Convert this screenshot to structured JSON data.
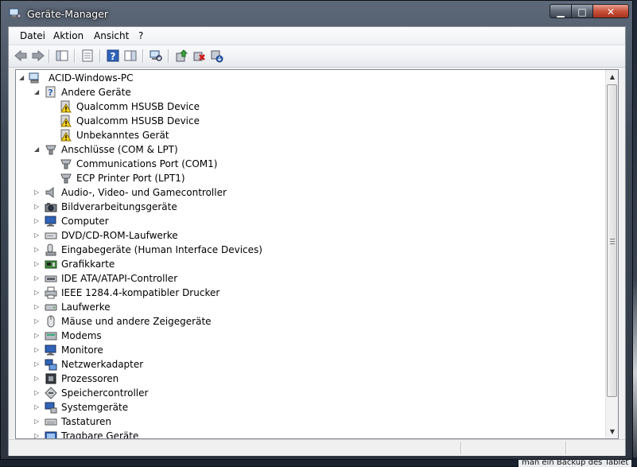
{
  "window": {
    "title": "Geräte-Manager",
    "minimize_glyph": "▁",
    "maximize_glyph": "□",
    "close_glyph": "✕"
  },
  "menu": [
    "Datei",
    "Aktion",
    "Ansicht",
    "?"
  ],
  "toolbar": [
    "back-icon",
    "forward-icon",
    "show-hide-console-tree-icon",
    "properties-icon",
    "help-icon",
    "action-pane-icon",
    "scan-hardware-icon",
    "update-driver-icon",
    "uninstall-icon",
    "disable-icon"
  ],
  "tree": {
    "root": "ACID-Windows-PC",
    "items": [
      {
        "label": "Andere Geräte",
        "level": 1,
        "expanded": true,
        "icon": "unknown-device-icon"
      },
      {
        "label": "Qualcomm HSUSB Device",
        "level": 2,
        "icon": "warning-device-icon"
      },
      {
        "label": "Qualcomm HSUSB Device",
        "level": 2,
        "icon": "warning-device-icon"
      },
      {
        "label": "Unbekanntes Gerät",
        "level": 2,
        "icon": "warning-device-icon"
      },
      {
        "label": "Anschlüsse (COM & LPT)",
        "level": 1,
        "expanded": true,
        "icon": "port-icon"
      },
      {
        "label": "Communications Port (COM1)",
        "level": 2,
        "icon": "port-icon"
      },
      {
        "label": "ECP Printer Port (LPT1)",
        "level": 2,
        "icon": "port-icon"
      },
      {
        "label": "Audio-, Video- und Gamecontroller",
        "level": 1,
        "expanded": false,
        "icon": "speaker-icon"
      },
      {
        "label": "Bildverarbeitungsgeräte",
        "level": 1,
        "expanded": false,
        "icon": "camera-icon"
      },
      {
        "label": "Computer",
        "level": 1,
        "expanded": false,
        "icon": "monitor-icon"
      },
      {
        "label": "DVD/CD-ROM-Laufwerke",
        "level": 1,
        "expanded": false,
        "icon": "optical-drive-icon"
      },
      {
        "label": "Eingabegeräte (Human Interface Devices)",
        "level": 1,
        "expanded": false,
        "icon": "hid-icon"
      },
      {
        "label": "Grafikkarte",
        "level": 1,
        "expanded": false,
        "icon": "display-adapter-icon"
      },
      {
        "label": "IDE ATA/ATAPI-Controller",
        "level": 1,
        "expanded": false,
        "icon": "ide-controller-icon"
      },
      {
        "label": "IEEE 1284.4-kompatibler Drucker",
        "level": 1,
        "expanded": false,
        "icon": "printer-icon"
      },
      {
        "label": "Laufwerke",
        "level": 1,
        "expanded": false,
        "icon": "disk-drive-icon"
      },
      {
        "label": "Mäuse und andere Zeigegeräte",
        "level": 1,
        "expanded": false,
        "icon": "mouse-icon"
      },
      {
        "label": "Modems",
        "level": 1,
        "expanded": false,
        "icon": "modem-icon"
      },
      {
        "label": "Monitore",
        "level": 1,
        "expanded": false,
        "icon": "monitor-icon"
      },
      {
        "label": "Netzwerkadapter",
        "level": 1,
        "expanded": false,
        "icon": "network-adapter-icon"
      },
      {
        "label": "Prozessoren",
        "level": 1,
        "expanded": false,
        "icon": "processor-icon"
      },
      {
        "label": "Speichercontroller",
        "level": 1,
        "expanded": false,
        "icon": "storage-controller-icon"
      },
      {
        "label": "Systemgeräte",
        "level": 1,
        "expanded": false,
        "icon": "system-device-icon"
      },
      {
        "label": "Tastaturen",
        "level": 1,
        "expanded": false,
        "icon": "keyboard-icon"
      },
      {
        "label": "Tragbare Geräte",
        "level": 1,
        "expanded": false,
        "icon": "portable-device-icon"
      }
    ]
  },
  "background_text": "man ein Backup des Tablet"
}
